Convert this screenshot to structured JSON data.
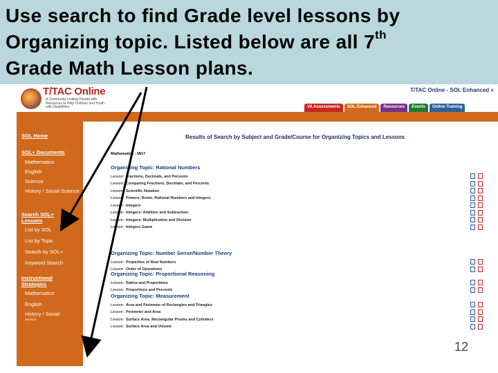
{
  "slide": {
    "title_line1": "Use search to find Grade level lessons by",
    "title_line2a": "Organizing topic.  Listed below are all 7",
    "title_line2_sup": "th",
    "title_line3": "Grade Math Lesson plans.",
    "slide_number": "12"
  },
  "site": {
    "logo_text": "T/TAC Online",
    "logo_tagline": "A Community Linking People with Resources to Help Children and Youth with Disabilities",
    "title": "T/TAC Online - SOL Enhanced +",
    "nav_tabs": [
      {
        "label": "VA Assessments",
        "color": "#c8261e"
      },
      {
        "label": "SOL Enhanced",
        "color": "#d0691c"
      },
      {
        "label": "Resources",
        "color": "#7a2f8a"
      },
      {
        "label": "Events",
        "color": "#1f7a2e"
      },
      {
        "label": "Online Training",
        "color": "#2f5f9a"
      }
    ]
  },
  "sidebar": {
    "sol_home": "SOL Home",
    "sol_documents": "SOL+ Documents",
    "doc_links": [
      "Mathematics",
      "English",
      "Science",
      "History / Social Science"
    ],
    "search_head": "Search SOL+ Lessons",
    "search_links": [
      "List by SOL",
      "List by Topic",
      "Search by SOL+",
      "Keyword Search"
    ],
    "instructional": "Instructional Strategies",
    "strategy_links": [
      "Mathematics",
      "English",
      "History / Social"
    ],
    "strategy_sub": "Science"
  },
  "content": {
    "results_title": "Results of Search by Subject and Grade/Course for Organizing Topics and Lessons",
    "crumb": "Mathematics : MG7",
    "topics": [
      {
        "heading": "Organizing Topic: Rational Numbers",
        "lessons": [
          {
            "label": "Lesson:",
            "title": "Fractions, Decimals, and Percents"
          },
          {
            "label": "Lesson:",
            "title": "Comparing Fractions, Decimals, and Percents"
          },
          {
            "label": "Lesson:",
            "title": "Scientific Notation"
          },
          {
            "label": "Lesson:",
            "title": "Powers, Roots, Rational Numbers and Integers"
          },
          {
            "label": "Lesson:",
            "title": "Integers"
          },
          {
            "label": "Lesson:",
            "title": "Integers: Addition and Subtraction"
          },
          {
            "label": "Lesson:",
            "title": "Integers: Multiplication and Division"
          },
          {
            "label": "Lesson:",
            "title": "Integers Game"
          }
        ]
      },
      {
        "heading": "Organizing Topic: Number Sense/Number Theory",
        "lessons": [
          {
            "label": "Lesson:",
            "title": "Properties of Real Numbers"
          },
          {
            "label": "Lesson:",
            "title": "Order of Operations"
          }
        ]
      },
      {
        "heading": "Organizing Topic: Proportional Reasoning",
        "lessons": [
          {
            "label": "Lesson:",
            "title": "Ratios and Proportions"
          },
          {
            "label": "Lesson:",
            "title": "Proportions and Percents"
          }
        ]
      },
      {
        "heading": "Organizing Topic: Measurement",
        "lessons": [
          {
            "label": "Lesson:",
            "title": "Area and Perimeter of Rectangles and Triangles"
          },
          {
            "label": "Lesson:",
            "title": "Perimeter and Area"
          },
          {
            "label": "Lesson:",
            "title": "Surface Area: Rectangular Prisms and Cylinders"
          },
          {
            "label": "Lesson:",
            "title": "Surface Area and Volume"
          }
        ]
      }
    ]
  },
  "icons": {
    "doc": "document-icon",
    "pdf": "pdf-icon"
  },
  "colors": {
    "title_band": "#b9d7dc",
    "sidebar": "#d0691c",
    "topic_heading": "#1a3c78",
    "arrow": "#000000"
  }
}
